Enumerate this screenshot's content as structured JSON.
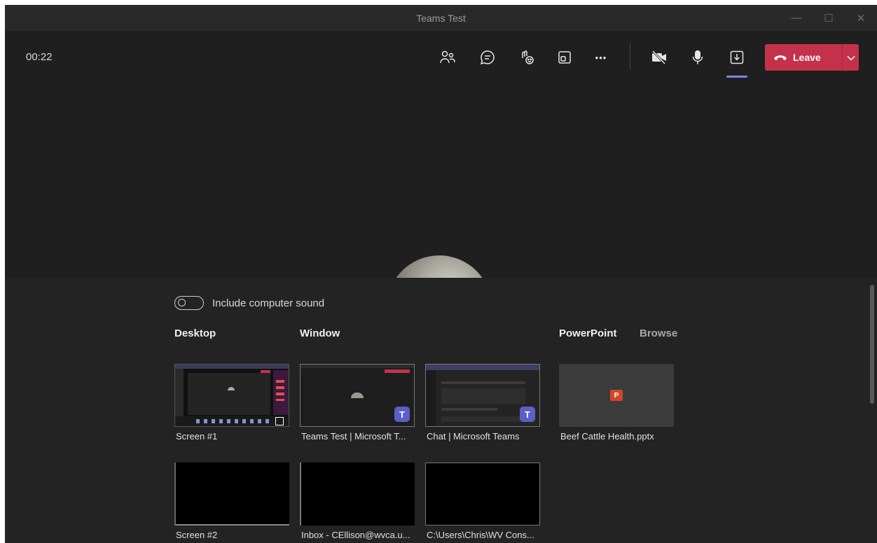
{
  "window": {
    "title": "Teams Test",
    "controls": {
      "minimize": "—",
      "maximize": "☐",
      "close": "✕"
    }
  },
  "callbar": {
    "timer": "00:22",
    "leave_label": "Leave",
    "icons": [
      "participants-icon",
      "chat-icon",
      "reactions-icon",
      "rooms-icon",
      "more-icon",
      "camera-off-icon",
      "microphone-icon",
      "share-tray-icon",
      "hang-up-icon",
      "chevron-down-icon"
    ],
    "more_glyph": "•••",
    "accent_color": "#c4314b",
    "active_underline_color": "#7f85f5"
  },
  "share_tray": {
    "toggle_label": "Include computer sound",
    "toggle_state": "off",
    "sections": {
      "desktop": "Desktop",
      "window": "Window",
      "powerpoint": "PowerPoint",
      "browse": "Browse"
    },
    "tiles": {
      "screen1": "Screen #1",
      "teams_window": "Teams Test | Microsoft T...",
      "chat_window": "Chat | Microsoft Teams",
      "ppt_file": "Beef Cattle Health.pptx",
      "screen2": "Screen #2",
      "inbox_window": "Inbox - CEllison@wvca.u...",
      "explorer_window": "C:\\Users\\Chris\\WV Cons..."
    },
    "teams_badge": "T",
    "ppt_badge": "P"
  }
}
